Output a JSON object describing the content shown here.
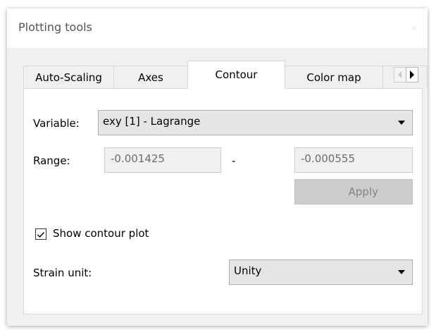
{
  "window": {
    "title": "Plotting tools",
    "close_label": "×"
  },
  "tabs": [
    {
      "label": "Auto-Scaling",
      "active": false
    },
    {
      "label": "Axes",
      "active": false
    },
    {
      "label": "Contour",
      "active": true
    },
    {
      "label": "Color map",
      "active": false
    }
  ],
  "tab_scroll": {
    "left_icon": "arrow-left-icon",
    "right_icon": "arrow-right-icon"
  },
  "contour": {
    "variable_label": "Variable:",
    "variable_value": "exy [1] - Lagrange",
    "range_label": "Range:",
    "range_min": "-0.001425",
    "range_separator": "-",
    "range_max": "-0.000555",
    "apply_label": "Apply",
    "show_contour_label": "Show contour plot",
    "show_contour_checked": true,
    "strain_unit_label": "Strain unit:",
    "strain_unit_value": "Unity"
  }
}
